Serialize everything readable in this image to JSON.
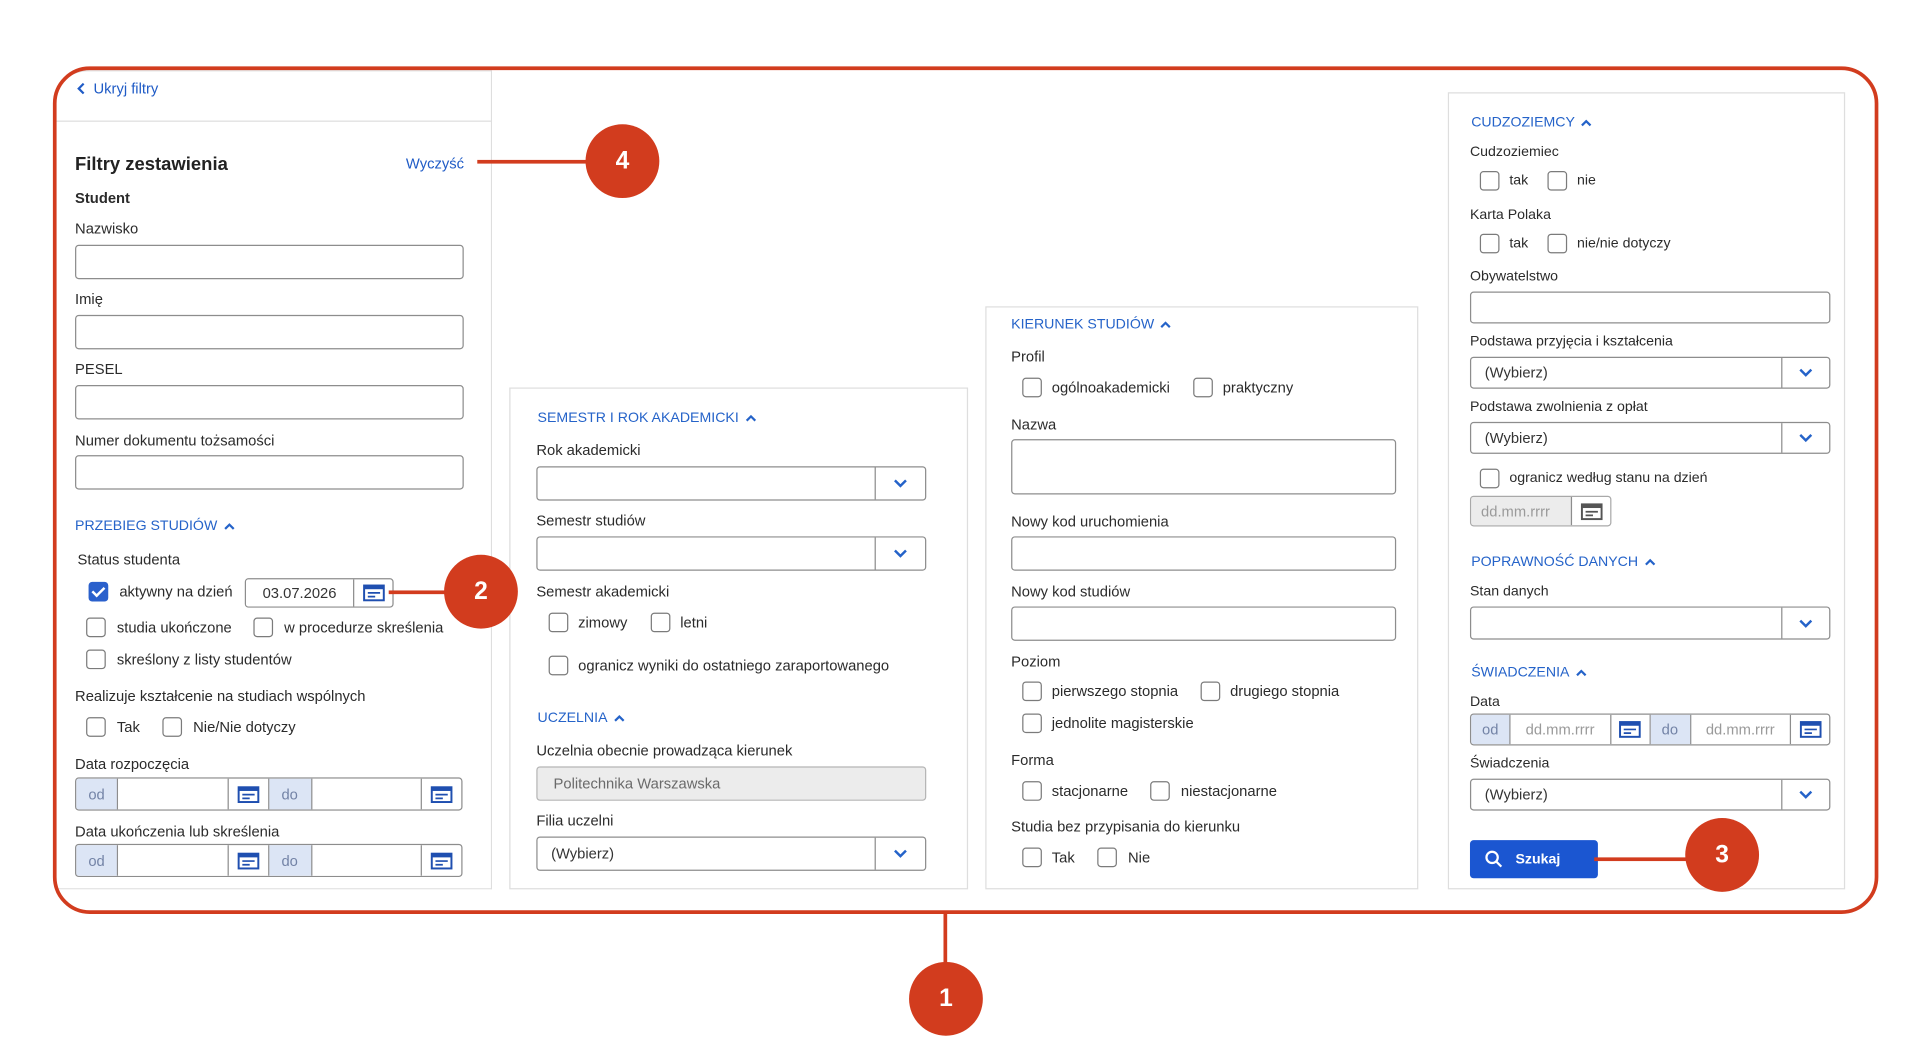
{
  "theme": {
    "accent": "#2563c9",
    "link": "#1f5bc6",
    "callout": "#d23c1e",
    "primary_button": "#1b56d1",
    "check_on": "#2a60cc",
    "prefix_bg": "#dce5f5"
  },
  "header": {
    "hide_filters": "Ukryj filtry",
    "title": "Filtry zestawienia",
    "clear": "Wyczyść"
  },
  "student": {
    "heading": "Student",
    "surname_label": "Nazwisko",
    "first_name_label": "Imię",
    "pesel_label": "PESEL",
    "id_document_label": "Numer dokumentu tożsamości"
  },
  "przebieg": {
    "heading": "PRZEBIEG STUDIÓW",
    "status_label": "Status studenta",
    "status_options": [
      {
        "label": "aktywny na dzień",
        "checked": true
      },
      {
        "label": "studia ukończone",
        "checked": false
      },
      {
        "label": "w procedurze skreślenia",
        "checked": false
      },
      {
        "label": "skreślony z listy studentów",
        "checked": false
      }
    ],
    "active_date": "03.07.2026",
    "joint_label": "Realizuje kształcenie na studiach wspólnych",
    "joint_options": [
      {
        "label": "Tak",
        "checked": false
      },
      {
        "label": "Nie/Nie dotyczy",
        "checked": false
      }
    ],
    "start_label": "Data rozpoczęcia",
    "end_label": "Data ukończenia lub skreślenia",
    "range_from": "od",
    "range_to": "do"
  },
  "semestr": {
    "heading": "SEMESTR I ROK AKADEMICKI",
    "academic_year_label": "Rok akademicki",
    "study_semester_label": "Semestr studiów",
    "academic_semester_label": "Semestr akademicki",
    "semester_options": [
      {
        "label": "zimowy",
        "checked": false
      },
      {
        "label": "letni",
        "checked": false
      }
    ],
    "limit_option": {
      "label": "ogranicz wyniki do ostatniego zaraportowanego",
      "checked": false
    }
  },
  "uczelnia": {
    "heading": "UCZELNIA",
    "current_label": "Uczelnia obecnie prowadząca kierunek",
    "current_value": "Politechnika Warszawska",
    "branch_label": "Filia uczelni",
    "branch_selected": "(Wybierz)"
  },
  "kierunek": {
    "heading": "KIERUNEK STUDIÓW",
    "profile_label": "Profil",
    "profile_options": [
      {
        "label": "ogólnoakademicki",
        "checked": false
      },
      {
        "label": "praktyczny",
        "checked": false
      }
    ],
    "name_label": "Nazwa",
    "launch_code_label": "Nowy kod uruchomienia",
    "study_code_label": "Nowy kod studiów",
    "level_label": "Poziom",
    "level_options": [
      {
        "label": "pierwszego stopnia",
        "checked": false
      },
      {
        "label": "drugiego stopnia",
        "checked": false
      },
      {
        "label": "jednolite magisterskie",
        "checked": false
      }
    ],
    "form_label": "Forma",
    "form_options": [
      {
        "label": "stacjonarne",
        "checked": false
      },
      {
        "label": "niestacjonarne",
        "checked": false
      }
    ],
    "unassigned_label": "Studia bez przypisania do kierunku",
    "unassigned_options": [
      {
        "label": "Tak",
        "checked": false
      },
      {
        "label": "Nie",
        "checked": false
      }
    ]
  },
  "cudzoziemcy": {
    "heading": "CUDZOZIEMCY",
    "foreigner_label": "Cudzoziemiec",
    "foreigner_options": [
      {
        "label": "tak",
        "checked": false
      },
      {
        "label": "nie",
        "checked": false
      }
    ],
    "pole_card_label": "Karta Polaka",
    "pole_card_options": [
      {
        "label": "tak",
        "checked": false
      },
      {
        "label": "nie/nie dotyczy",
        "checked": false
      }
    ],
    "citizenship_label": "Obywatelstwo",
    "admission_basis_label": "Podstawa przyjęcia i kształcenia",
    "admission_basis_selected": "(Wybierz)",
    "fee_exemption_label": "Podstawa zwolnienia z opłat",
    "fee_exemption_selected": "(Wybierz)",
    "state_limit_option": {
      "label": "ogranicz według stanu na dzień",
      "checked": false
    },
    "state_date_placeholder": "dd.mm.rrrr"
  },
  "poprawnosc": {
    "heading": "POPRAWNOŚĆ DANYCH",
    "data_state_label": "Stan danych"
  },
  "swiadczenia": {
    "heading": "ŚWIADCZENIA",
    "date_label": "Data",
    "range_from": "od",
    "range_to": "do",
    "date_placeholder": "dd.mm.rrrr",
    "benefits_label": "Świadczenia",
    "benefits_selected": "(Wybierz)",
    "search_button": "Szukaj"
  },
  "callouts": {
    "frame": "1",
    "date_picker": "2",
    "search": "3",
    "clear": "4"
  }
}
